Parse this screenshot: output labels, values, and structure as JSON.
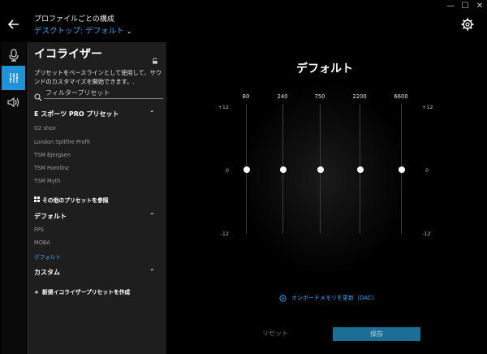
{
  "window": {
    "minimize_glyph": "—",
    "maximize_glyph": "☐",
    "close_glyph": "✕"
  },
  "header": {
    "back_icon": "back-arrow-icon",
    "profile_label": "プロファイルごとの構成",
    "profile_value": "デスクトップ: デフォルト",
    "settings_icon": "gear-icon"
  },
  "iconbar": {
    "items": [
      {
        "name": "microphone-icon",
        "active": false
      },
      {
        "name": "equalizer-icon",
        "active": true
      },
      {
        "name": "speaker-icon",
        "active": false
      }
    ]
  },
  "panel": {
    "title": "イコライザー",
    "description": "プリセットをベースラインとして使用して、サウンドのカスタマイズを開始できます。.",
    "search_placeholder": "フィルタープリセット",
    "sections": {
      "esports": {
        "title": "E スポーツ PRO プリセット",
        "items": [
          "G2 shox",
          "London Spitfire Profit",
          "TSM Bjergsen",
          "TSM Hamlinz",
          "TSM Myth"
        ],
        "browse_label": "その他のプリセットを参照"
      },
      "default": {
        "title": "デフォルト",
        "items": [
          "FPS",
          "MOBA",
          "デフォルト"
        ],
        "selected": "デフォルト"
      },
      "custom": {
        "title": "カスタム",
        "create_label": "新規イコライザープリセットを作成"
      }
    }
  },
  "main": {
    "title": "デフォルト",
    "db_top": "+12",
    "db_mid": "0",
    "db_bottom": "-12",
    "bands": [
      {
        "freq": "80",
        "gain": 0
      },
      {
        "freq": "240",
        "gain": 0
      },
      {
        "freq": "750",
        "gain": 0
      },
      {
        "freq": "2200",
        "gain": 0
      },
      {
        "freq": "6600",
        "gain": 0
      }
    ],
    "dac_label": "オンボードメモリを更新（DAC）",
    "reset_label": "リセット",
    "save_label": "保存"
  },
  "colors": {
    "accent": "#3fa9f5",
    "active_tab": "#1f93d6",
    "save_button": "#1b6e93",
    "panel_bg": "#1e1e1e"
  }
}
